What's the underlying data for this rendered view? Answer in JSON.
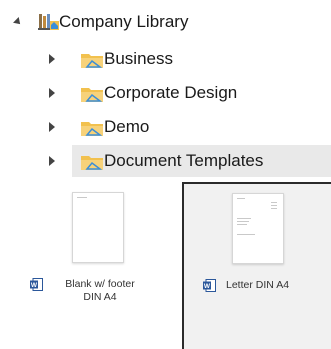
{
  "tree": {
    "root": {
      "label": "Company Library",
      "icon": "library-icon",
      "expanded": true
    },
    "children": [
      {
        "label": "Business",
        "icon": "folder-icon",
        "selected": false
      },
      {
        "label": "Corporate Design",
        "icon": "folder-icon",
        "selected": false
      },
      {
        "label": "Demo",
        "icon": "folder-icon",
        "selected": false
      },
      {
        "label": "Document Templates",
        "icon": "folder-icon",
        "selected": true
      }
    ]
  },
  "templates": [
    {
      "line1": "Blank w/ footer",
      "line2": "DIN A4",
      "icon": "word-icon",
      "selected": false
    },
    {
      "line1": "Letter DIN A4",
      "line2": "",
      "icon": "word-icon",
      "selected": true
    }
  ],
  "colors": {
    "folder": "#f2c14e",
    "folder_accent": "#3b8ed8",
    "word": "#2b579a",
    "selection": "#e9e9e9"
  }
}
